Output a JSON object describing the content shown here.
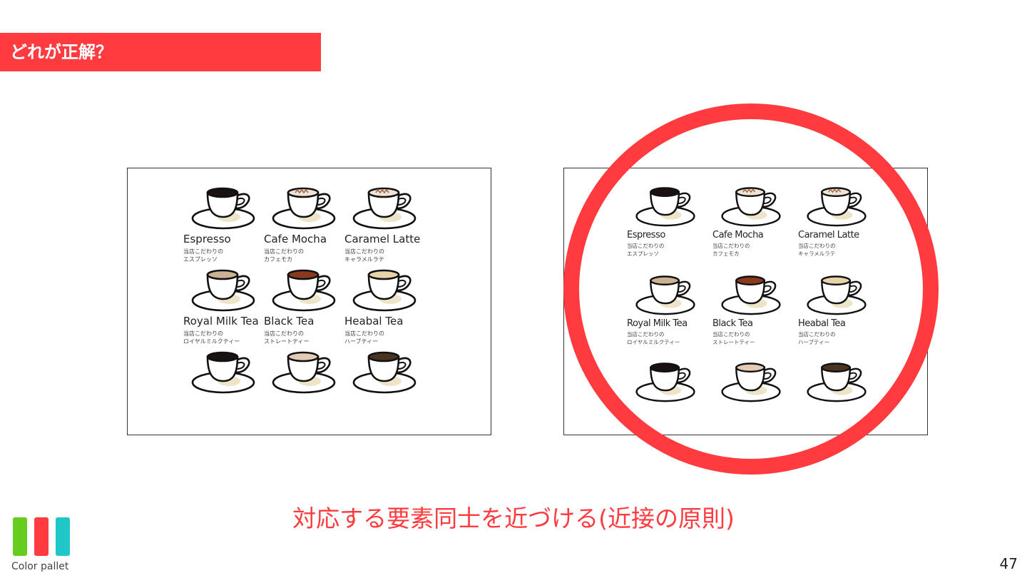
{
  "slide": {
    "title": "どれが正解？",
    "caption": "対応する要素同士を近づける(近接の原則)",
    "page_number": "47",
    "pallet_label": "Color pallet",
    "accent_color": "#ff3b3f"
  },
  "pallet": {
    "colors": [
      "#66cc1e",
      "#ff3b3f",
      "#1fc7c9"
    ]
  },
  "menu": {
    "items": [
      {
        "name": "Espresso",
        "desc1": "当店こだわりの",
        "desc2": "エスプレッソ",
        "coffee": "#1a1210",
        "foam": false
      },
      {
        "name": "Cafe Mocha",
        "desc1": "当店こだわりの",
        "desc2": "カフェモカ",
        "coffee": "#efe3d6",
        "foam": true
      },
      {
        "name": "Caramel Latte",
        "desc1": "当店こだわりの",
        "desc2": "キャラメルラテ",
        "coffee": "#efe3d6",
        "foam": true
      },
      {
        "name": "Royal Milk Tea",
        "desc1": "当店こだわりの",
        "desc2": "ロイヤルミルクティー",
        "coffee": "#cbb292",
        "foam": false
      },
      {
        "name": "Black Tea",
        "desc1": "当店こだわりの",
        "desc2": "ストレートティー",
        "coffee": "#8a3a1c",
        "foam": false
      },
      {
        "name": "Heabal Tea",
        "desc1": "当店こだわりの",
        "desc2": "ハーブティー",
        "coffee": "#e8d2a8",
        "foam": false
      }
    ],
    "bottom_cups": [
      {
        "coffee": "#1a1210"
      },
      {
        "coffee": "#e4ccb4"
      },
      {
        "coffee": "#4a3320"
      }
    ]
  }
}
